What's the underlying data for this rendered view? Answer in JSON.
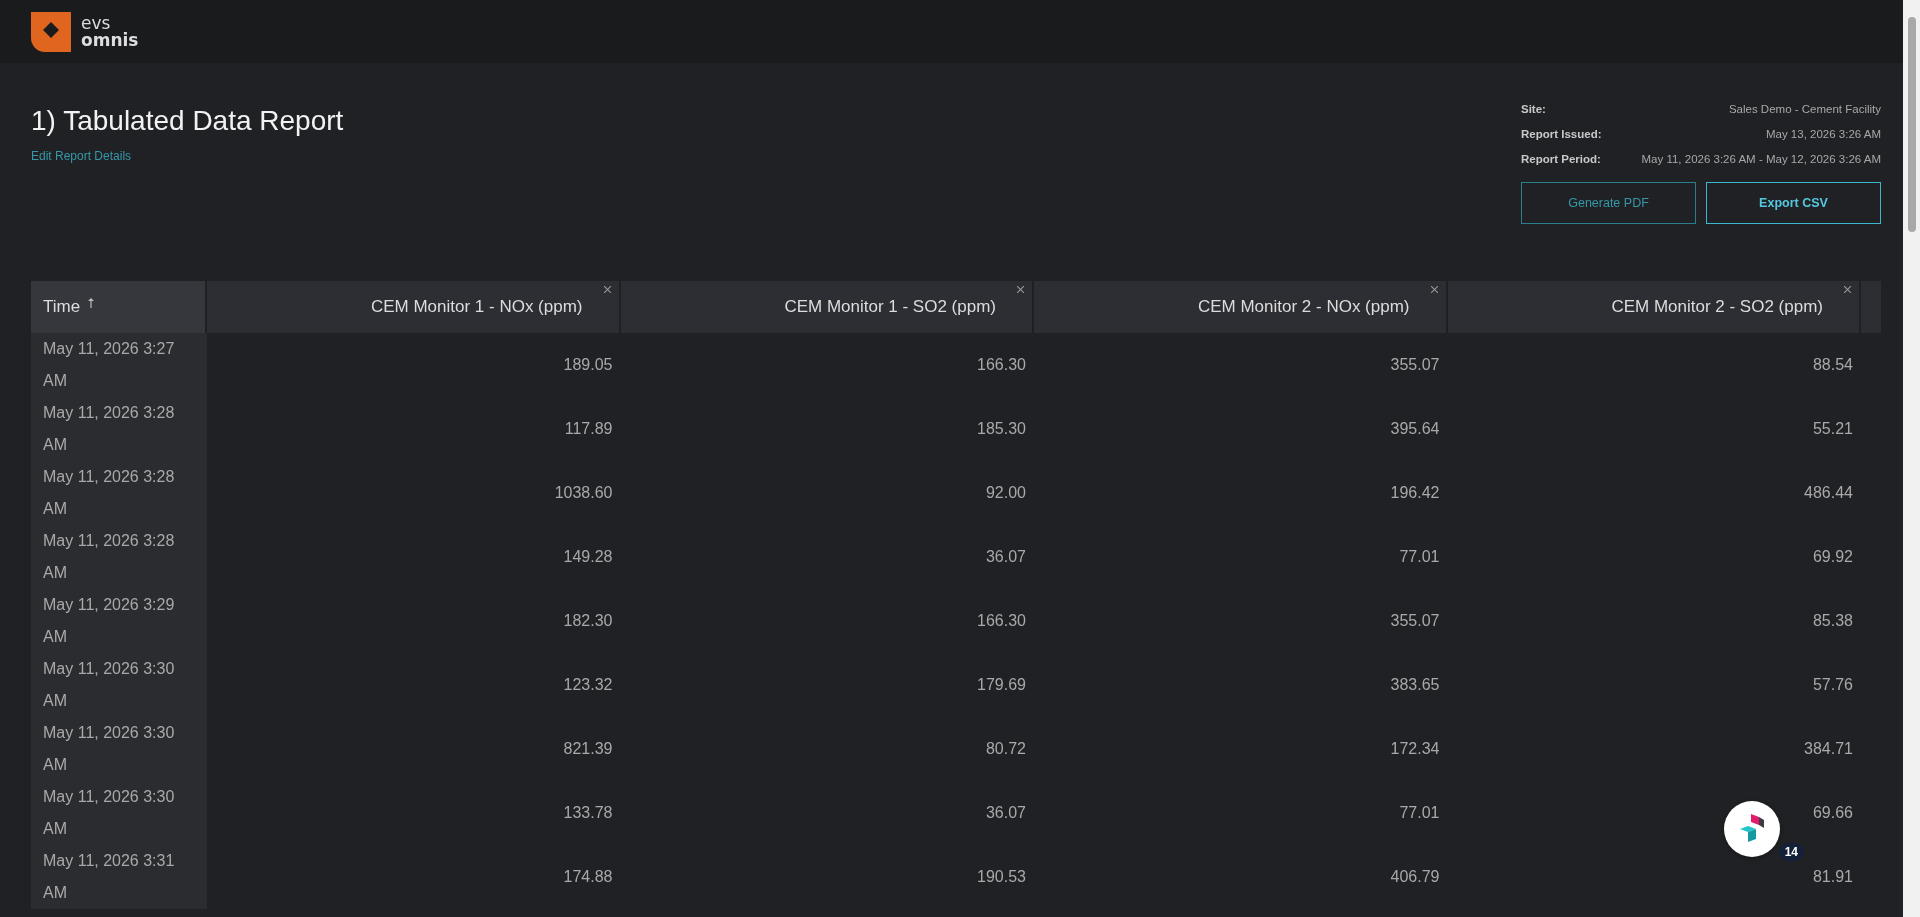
{
  "header": {
    "logo_text_top": "evs",
    "logo_text_bottom": "omnis"
  },
  "report": {
    "title": "1) Tabulated Data Report",
    "edit_link": "Edit Report Details",
    "details": [
      {
        "label": "Site:",
        "value": "Sales Demo - Cement Facility"
      },
      {
        "label": "Report Issued:",
        "value": "May 13, 2026 3:26 AM"
      },
      {
        "label": "Report Period:",
        "value": "May 11, 2026 3:26 AM - May 12, 2026 3:26 AM"
      }
    ],
    "buttons": [
      {
        "label": "Generate PDF",
        "kind": "secondary"
      },
      {
        "label": "Export CSV",
        "kind": "primary"
      }
    ]
  },
  "table": {
    "columns": [
      {
        "label": "Time",
        "kind": "time"
      },
      {
        "label": "CEM Monitor 1 - NOx (ppm)",
        "kind": "value"
      },
      {
        "label": "CEM Monitor 1 - SO2 (ppm)",
        "kind": "value"
      },
      {
        "label": "CEM Monitor 2 - NOx (ppm)",
        "kind": "value"
      },
      {
        "label": "CEM Monitor 2 - SO2 (ppm)",
        "kind": "value"
      }
    ],
    "rows": [
      [
        "May 11, 2026 3:27 AM",
        "189.05",
        "166.30",
        "355.07",
        "88.54"
      ],
      [
        "May 11, 2026 3:28 AM",
        "117.89",
        "185.30",
        "395.64",
        "55.21"
      ],
      [
        "May 11, 2026 3:28 AM",
        "1038.60",
        "92.00",
        "196.42",
        "486.44"
      ],
      [
        "May 11, 2026 3:28 AM",
        "149.28",
        "36.07",
        "77.01",
        "69.92"
      ],
      [
        "May 11, 2026 3:29 AM",
        "182.30",
        "166.30",
        "355.07",
        "85.38"
      ],
      [
        "May 11, 2026 3:30 AM",
        "123.32",
        "179.69",
        "383.65",
        "57.76"
      ],
      [
        "May 11, 2026 3:30 AM",
        "821.39",
        "80.72",
        "172.34",
        "384.71"
      ],
      [
        "May 11, 2026 3:30 AM",
        "133.78",
        "36.07",
        "77.01",
        "69.66"
      ],
      [
        "May 11, 2026 3:31 AM",
        "174.88",
        "190.53",
        "406.79",
        "81.91"
      ]
    ]
  },
  "chat_widget": {
    "badge": "14"
  }
}
